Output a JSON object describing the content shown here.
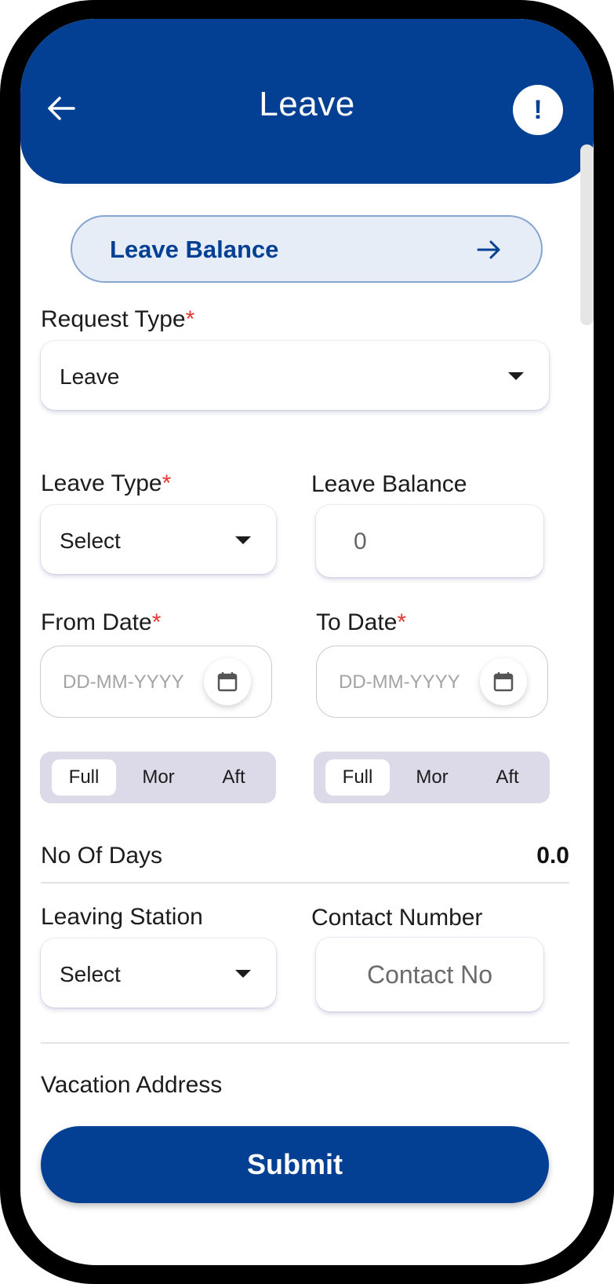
{
  "header": {
    "title": "Leave",
    "info_symbol": "!"
  },
  "balance_button": {
    "label": "Leave Balance"
  },
  "request_type": {
    "label": "Request Type",
    "required": "*",
    "value": "Leave"
  },
  "leave_type": {
    "label": "Leave Type",
    "required": "*",
    "value": "Select"
  },
  "leave_balance": {
    "label": "Leave Balance",
    "value": "0"
  },
  "from_date": {
    "label": "From Date",
    "required": "*",
    "placeholder": "DD-MM-YYYY"
  },
  "to_date": {
    "label": "To Date",
    "required": "*",
    "placeholder": "DD-MM-YYYY"
  },
  "from_session": {
    "options": [
      "Full",
      "Mor",
      "Aft"
    ],
    "selected": "Full"
  },
  "to_session": {
    "options": [
      "Full",
      "Mor",
      "Aft"
    ],
    "selected": "Full"
  },
  "no_of_days": {
    "label": "No Of Days",
    "value": "0.0"
  },
  "leaving_station": {
    "label": "Leaving Station",
    "value": "Select"
  },
  "contact_number": {
    "label": "Contact Number",
    "placeholder": "Contact No"
  },
  "vacation_address": {
    "label": "Vacation Address"
  },
  "submit": {
    "label": "Submit"
  },
  "colors": {
    "primary": "#034094",
    "required": "#e53935",
    "segment_bg": "#dcd9e8"
  },
  "icons": [
    "back-arrow-icon",
    "info-icon",
    "arrow-right-icon",
    "dropdown-caret-icon",
    "calendar-icon"
  ]
}
